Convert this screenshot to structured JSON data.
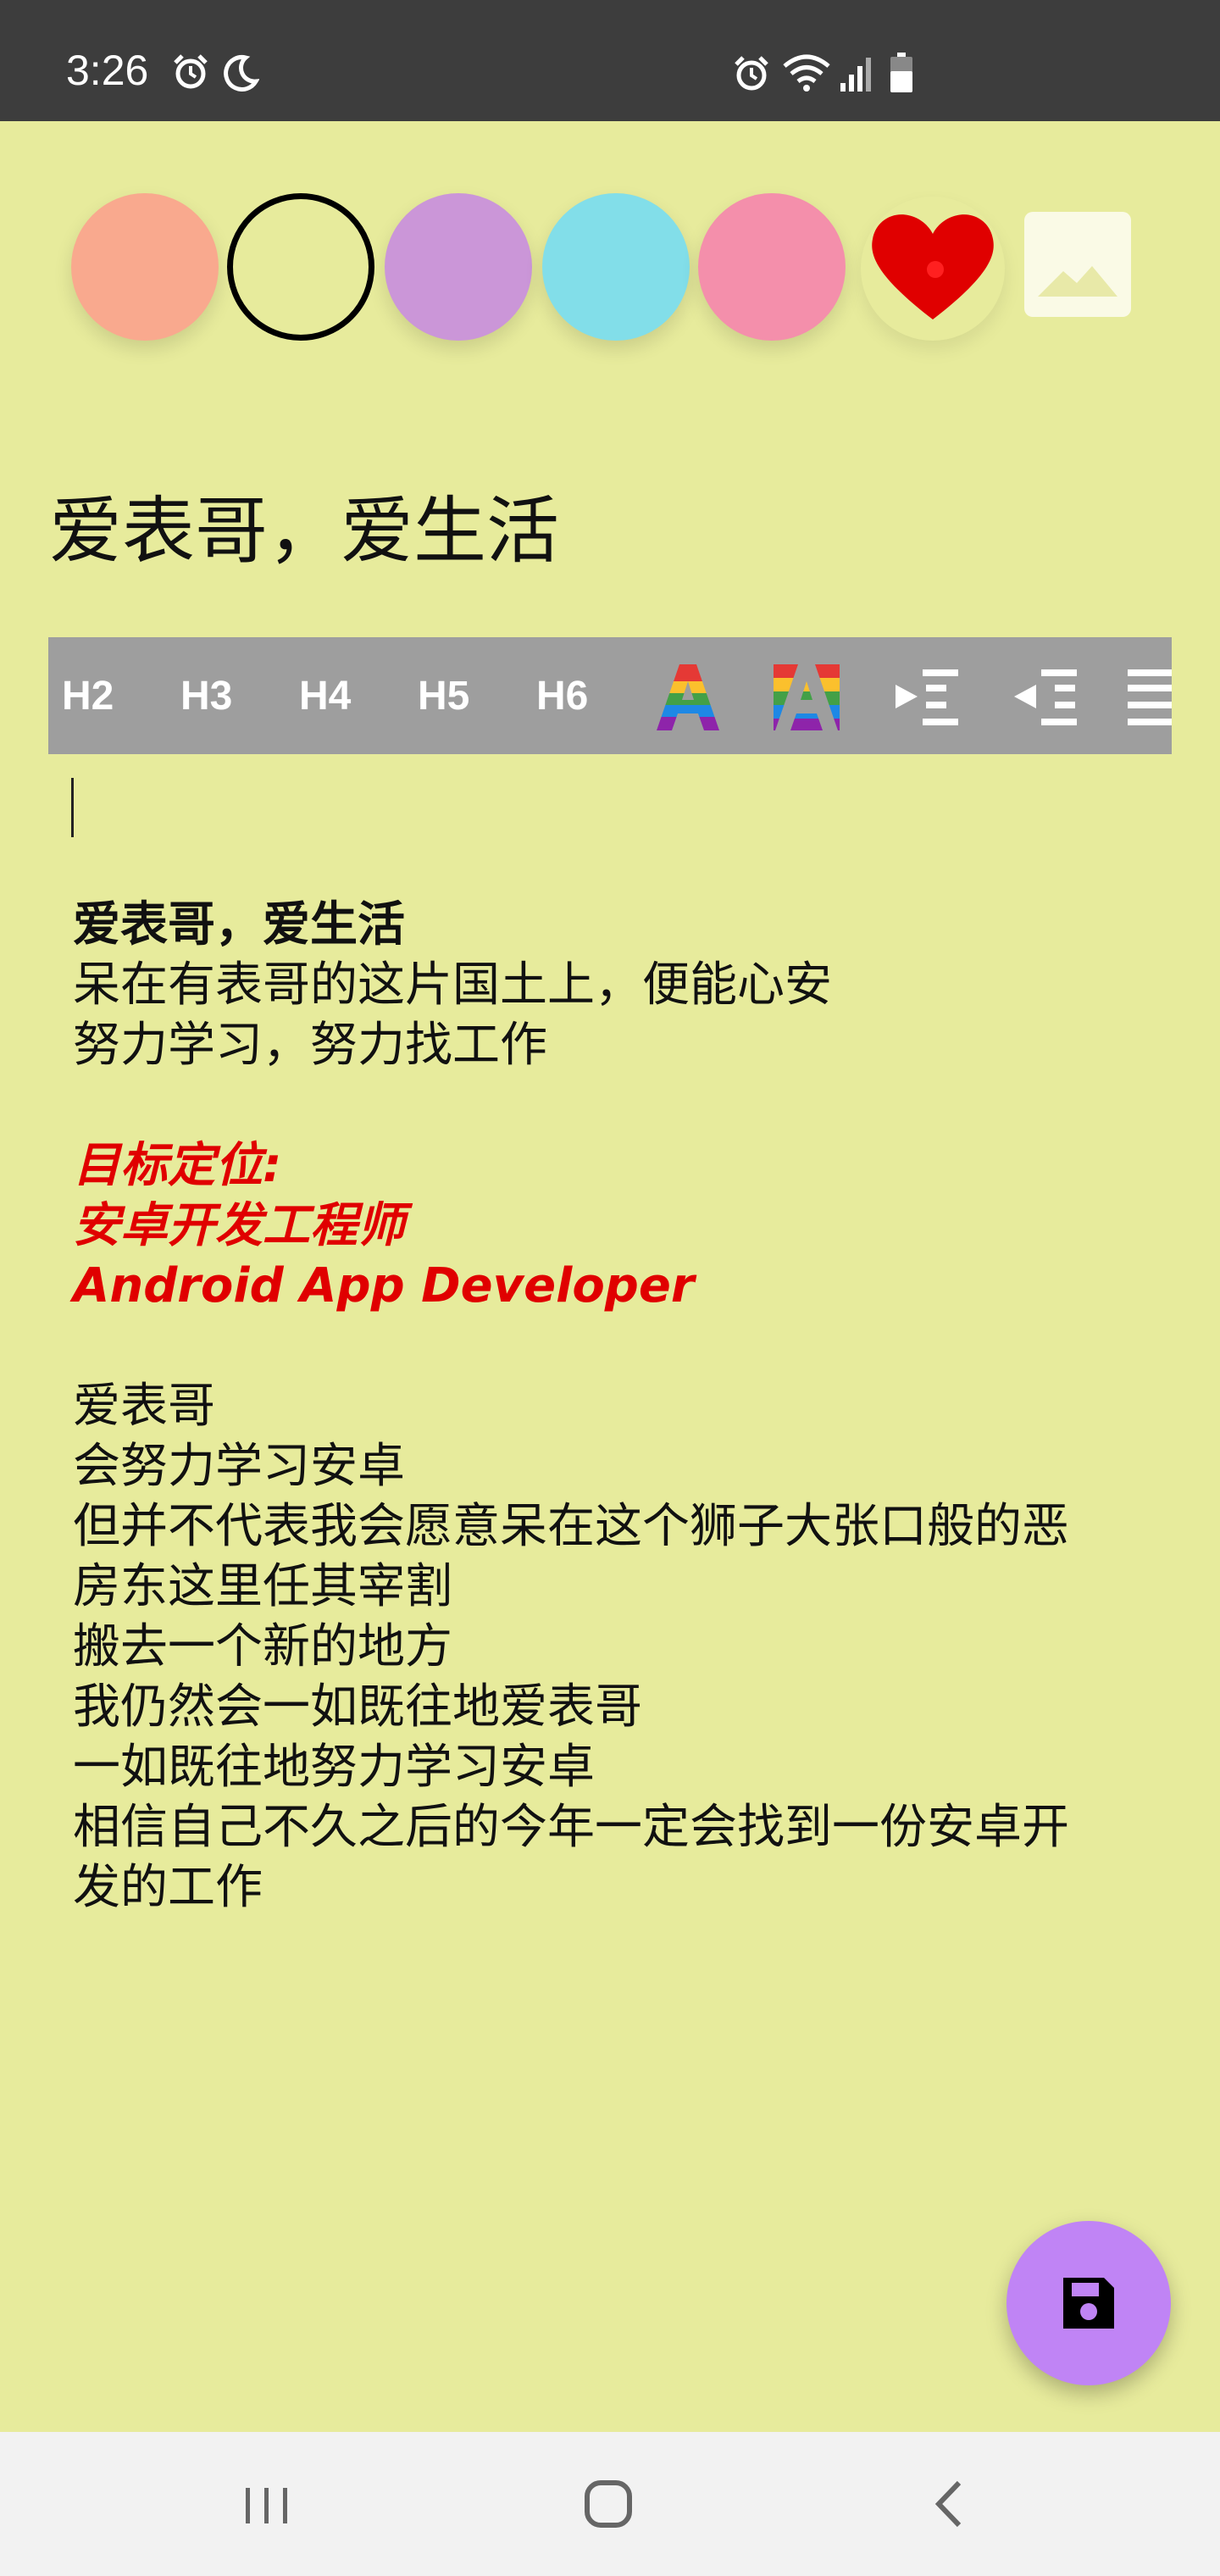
{
  "status_bar": {
    "time": "3:26",
    "left_icons": [
      "alarm-icon",
      "moon-icon"
    ],
    "right_icons": [
      "alarm-icon",
      "wifi-icon",
      "signal-icon",
      "battery-icon"
    ]
  },
  "color_picker": {
    "swatches": [
      {
        "name": "salmon",
        "color": "#f9a98e",
        "selected": false
      },
      {
        "name": "light-yellow",
        "color": "#e7eb9c",
        "selected": true
      },
      {
        "name": "purple",
        "color": "#cb96d8",
        "selected": false
      },
      {
        "name": "cyan",
        "color": "#82dee9",
        "selected": false
      },
      {
        "name": "pink",
        "color": "#f48fab",
        "selected": false
      }
    ],
    "heart_color": "#e00000",
    "image_icon": "image-icon"
  },
  "note": {
    "title": "爱表哥，爱生活"
  },
  "toolbar": {
    "headings": [
      "H2",
      "H3",
      "H4",
      "H5",
      "H6"
    ],
    "icons": [
      "text-color-icon",
      "background-color-icon",
      "indent-icon",
      "outdent-icon",
      "align-icon"
    ]
  },
  "editor": {
    "lines": [
      {
        "text": "爱表哥，爱生活",
        "style": "bold"
      },
      {
        "text": "呆在有表哥的这片国土上，便能心安",
        "style": "normal"
      },
      {
        "text": "努力学习，努力找工作",
        "style": "normal"
      },
      {
        "text": "",
        "style": "blank"
      },
      {
        "text": "目标定位:",
        "style": "red"
      },
      {
        "text": "安卓开发工程师",
        "style": "red"
      },
      {
        "text": "Android App Developer",
        "style": "red"
      },
      {
        "text": "",
        "style": "blank"
      },
      {
        "text": "爱表哥",
        "style": "normal"
      },
      {
        "text": "会努力学习安卓",
        "style": "normal"
      },
      {
        "text": "但并不代表我会愿意呆在这个狮子大张口般的恶",
        "style": "normal"
      },
      {
        "text": "房东这里任其宰割",
        "style": "normal"
      },
      {
        "text": "搬去一个新的地方",
        "style": "normal"
      },
      {
        "text": "我仍然会一如既往地爱表哥",
        "style": "normal"
      },
      {
        "text": "一如既往地努力学习安卓",
        "style": "normal"
      },
      {
        "text": "相信自己不久之后的今年一定会找到一份安卓开",
        "style": "normal"
      },
      {
        "text": "发的工作",
        "style": "normal"
      }
    ]
  },
  "fab": {
    "icon": "save-icon",
    "color": "#c084f5"
  },
  "nav_bar": {
    "icons": [
      "recents-icon",
      "home-icon",
      "back-icon"
    ]
  }
}
